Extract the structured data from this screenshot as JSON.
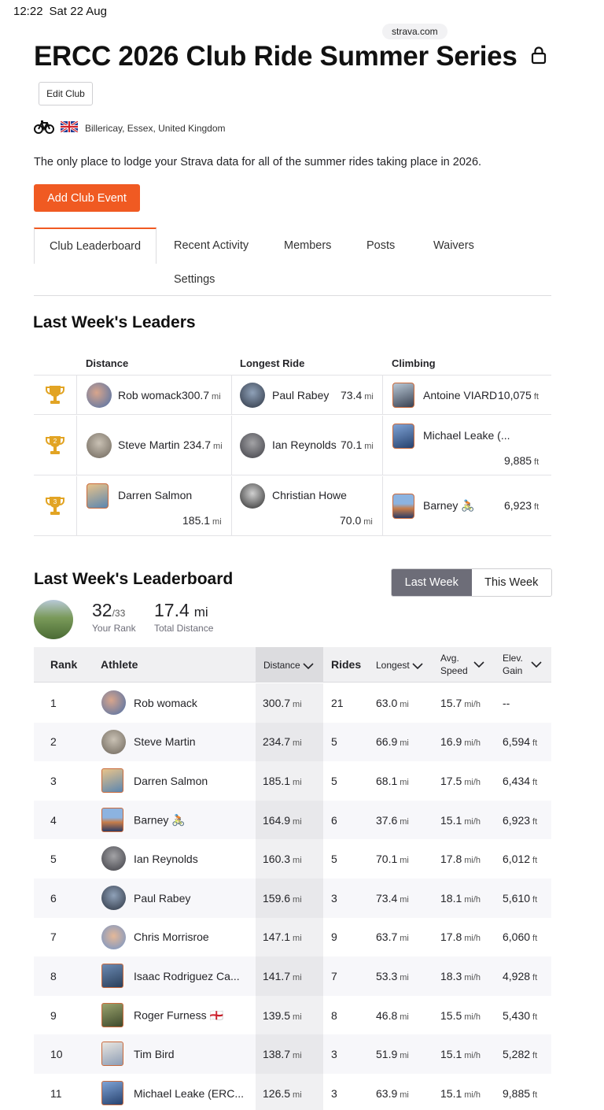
{
  "status_bar": {
    "time": "12:22",
    "date": "Sat 22 Aug"
  },
  "browser": {
    "url": "strava.com"
  },
  "club": {
    "title": "ERCC 2026 Club Ride Summer Series",
    "edit_label": "Edit Club",
    "location": "Billericay, Essex, United Kingdom",
    "description": "The only place to lodge your Strava data for all of the summer rides taking place in 2026.",
    "add_event_label": "Add Club Event"
  },
  "tabs": [
    "Club Leaderboard",
    "Recent Activity",
    "Members",
    "Posts",
    "Waivers",
    "Settings"
  ],
  "leaders": {
    "title": "Last Week's Leaders",
    "columns": [
      "Distance",
      "Longest Ride",
      "Climbing"
    ],
    "rows": [
      {
        "distance": {
          "name": "Rob womack",
          "value": "300.7",
          "unit": "mi"
        },
        "longest": {
          "name": "Paul Rabey",
          "value": "73.4",
          "unit": "mi"
        },
        "climbing": {
          "name": "Antoine VIARD",
          "value": "10,075",
          "unit": "ft"
        }
      },
      {
        "distance": {
          "name": "Steve Martin",
          "value": "234.7",
          "unit": "mi"
        },
        "longest": {
          "name": "Ian Reynolds",
          "value": "70.1",
          "unit": "mi"
        },
        "climbing": {
          "name": "Michael Leake (...",
          "value": "9,885",
          "unit": "ft"
        }
      },
      {
        "distance": {
          "name": "Darren Salmon",
          "value": "185.1",
          "unit": "mi"
        },
        "longest": {
          "name": "Christian Howe",
          "value": "70.0",
          "unit": "mi"
        },
        "climbing": {
          "name": "Barney 🚴🏼",
          "value": "6,923",
          "unit": "ft"
        }
      }
    ],
    "trophy_color": "#e2a424",
    "rank_labels": [
      "1",
      "2",
      "3"
    ]
  },
  "leaderboard": {
    "title": "Last Week's Leaderboard",
    "toggle": {
      "active": "Last Week",
      "inactive": "This Week"
    },
    "my_rank": "32",
    "my_rank_total": "/33",
    "my_rank_label": "Your Rank",
    "my_distance": "17.4",
    "my_distance_unit": "mi",
    "my_distance_label": "Total Distance",
    "headers": {
      "rank": "Rank",
      "athlete": "Athlete",
      "distance": "Distance",
      "rides": "Rides",
      "longest": "Longest",
      "avg_speed_1": "Avg.",
      "avg_speed_2": "Speed",
      "elev_1": "Elev.",
      "elev_2": "Gain"
    },
    "rows": [
      {
        "rank": "1",
        "athlete": "Rob womack",
        "distance": "300.7",
        "rides": "21",
        "longest": "63.0",
        "speed": "15.7",
        "elev": "--",
        "elev_unit": ""
      },
      {
        "rank": "2",
        "athlete": "Steve Martin",
        "distance": "234.7",
        "rides": "5",
        "longest": "66.9",
        "speed": "16.9",
        "elev": "6,594",
        "elev_unit": "ft"
      },
      {
        "rank": "3",
        "athlete": "Darren Salmon",
        "distance": "185.1",
        "rides": "5",
        "longest": "68.1",
        "speed": "17.5",
        "elev": "6,434",
        "elev_unit": "ft"
      },
      {
        "rank": "4",
        "athlete": "Barney 🚴🏼",
        "distance": "164.9",
        "rides": "6",
        "longest": "37.6",
        "speed": "15.1",
        "elev": "6,923",
        "elev_unit": "ft"
      },
      {
        "rank": "5",
        "athlete": "Ian Reynolds",
        "distance": "160.3",
        "rides": "5",
        "longest": "70.1",
        "speed": "17.8",
        "elev": "6,012",
        "elev_unit": "ft"
      },
      {
        "rank": "6",
        "athlete": "Paul Rabey",
        "distance": "159.6",
        "rides": "3",
        "longest": "73.4",
        "speed": "18.1",
        "elev": "5,610",
        "elev_unit": "ft"
      },
      {
        "rank": "7",
        "athlete": "Chris Morrisroe",
        "distance": "147.1",
        "rides": "9",
        "longest": "63.7",
        "speed": "17.8",
        "elev": "6,060",
        "elev_unit": "ft"
      },
      {
        "rank": "8",
        "athlete": "Isaac Rodriguez Ca...",
        "distance": "141.7",
        "rides": "7",
        "longest": "53.3",
        "speed": "18.3",
        "elev": "4,928",
        "elev_unit": "ft"
      },
      {
        "rank": "9",
        "athlete": "Roger Furness 🏴󠁧󠁢󠁥󠁮󠁧󠁿",
        "distance": "139.5",
        "rides": "8",
        "longest": "46.8",
        "speed": "15.5",
        "elev": "5,430",
        "elev_unit": "ft"
      },
      {
        "rank": "10",
        "athlete": "Tim Bird",
        "distance": "138.7",
        "rides": "3",
        "longest": "51.9",
        "speed": "15.1",
        "elev": "5,282",
        "elev_unit": "ft"
      },
      {
        "rank": "11",
        "athlete": "Michael Leake (ERC...",
        "distance": "126.5",
        "rides": "3",
        "longest": "63.9",
        "speed": "15.1",
        "elev": "9,885",
        "elev_unit": "ft"
      }
    ],
    "distance_unit": "mi",
    "speed_unit": "mi/h"
  },
  "colors": {
    "brand_orange": "#f05a22",
    "toggle_active": "#6d6d78"
  }
}
